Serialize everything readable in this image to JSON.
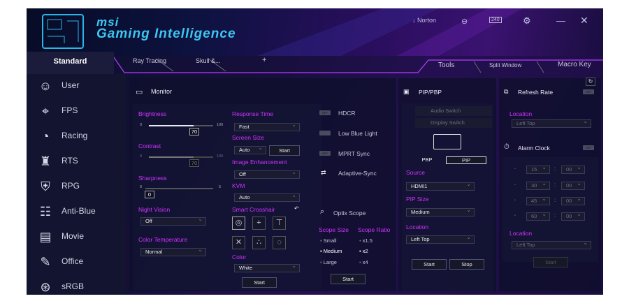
{
  "app": {
    "brand": "msi",
    "title": "Gaming Intelligence"
  },
  "titlebar": {
    "norton": "Norton",
    "badge": "240"
  },
  "tabs": {
    "standard": "Standard",
    "ray_tracing": "Ray Tracing",
    "skull": "Skull &...",
    "add": "+",
    "tools": "Tools",
    "split": "Split Window",
    "macro": "Macro Key"
  },
  "sidebar": {
    "items": [
      {
        "label": "User",
        "icon": "user-icon"
      },
      {
        "label": "FPS",
        "icon": "crosshair-icon"
      },
      {
        "label": "Racing",
        "icon": "speedometer-icon"
      },
      {
        "label": "RTS",
        "icon": "chess-icon"
      },
      {
        "label": "RPG",
        "icon": "shield-icon"
      },
      {
        "label": "Anti-Blue",
        "icon": "book-icon"
      },
      {
        "label": "Movie",
        "icon": "film-icon"
      },
      {
        "label": "Office",
        "icon": "pen-icon"
      },
      {
        "label": "sRGB",
        "icon": "rgb-circles-icon"
      }
    ]
  },
  "monitor": {
    "title": "Monitor",
    "brightness": {
      "label": "Brightness",
      "min": "0",
      "max": "100",
      "value": "70"
    },
    "contrast": {
      "label": "Contrast",
      "min": "0",
      "max": "100",
      "value": "70"
    },
    "sharpness": {
      "label": "Sharpness",
      "min": "0",
      "max": "5",
      "value": "0"
    },
    "night_vision": {
      "label": "Night Vision",
      "value": "Off"
    },
    "color_temp": {
      "label": "Color Temperature",
      "value": "Normal"
    },
    "response_time": {
      "label": "Response Time",
      "value": "Fast"
    },
    "screen_size": {
      "label": "Screen Size",
      "value": "Auto",
      "start": "Start"
    },
    "image_enh": {
      "label": "Image Enhancement",
      "value": "Off"
    },
    "kvm": {
      "label": "KVM",
      "value": "Auto"
    },
    "crosshair": {
      "label": "Smart Crosshair"
    },
    "color": {
      "label": "Color",
      "value": "White",
      "start": "Start"
    },
    "hdcr": "HDCR",
    "low_blue": "Low Blue Light",
    "mprt": "MPRT Sync",
    "adaptive": "Adaptive-Sync",
    "optix": {
      "title": "Optix Scope",
      "size_label": "Scope Size",
      "ratio_label": "Scope Ratio",
      "sizes": [
        "Small",
        "Medium",
        "Large"
      ],
      "ratios": [
        "x1.5",
        "x2",
        "x4"
      ],
      "start": "Start"
    }
  },
  "pip": {
    "title": "PIP/PBP",
    "audio": "Audio Switch",
    "display": "Display Switch",
    "pbp": "PBP",
    "pip": "PIP",
    "source_label": "Source",
    "source": "HDMI1",
    "size_label": "PIP Size",
    "size": "Medium",
    "location_label": "Location",
    "location": "Left Top",
    "start": "Start",
    "stop": "Stop"
  },
  "refresh": {
    "title": "Refresh Rate",
    "location_label": "Location",
    "location": "Left Top"
  },
  "alarm": {
    "title": "Alarm Clock",
    "rows": [
      [
        "15",
        "00"
      ],
      [
        "30",
        "00"
      ],
      [
        "45",
        "00"
      ],
      [
        "60",
        "00"
      ]
    ],
    "location_label": "Location",
    "location": "Left Top",
    "start": "Start"
  },
  "colors": {
    "accent": "#d233ff",
    "cyan": "#3cc6f2"
  }
}
